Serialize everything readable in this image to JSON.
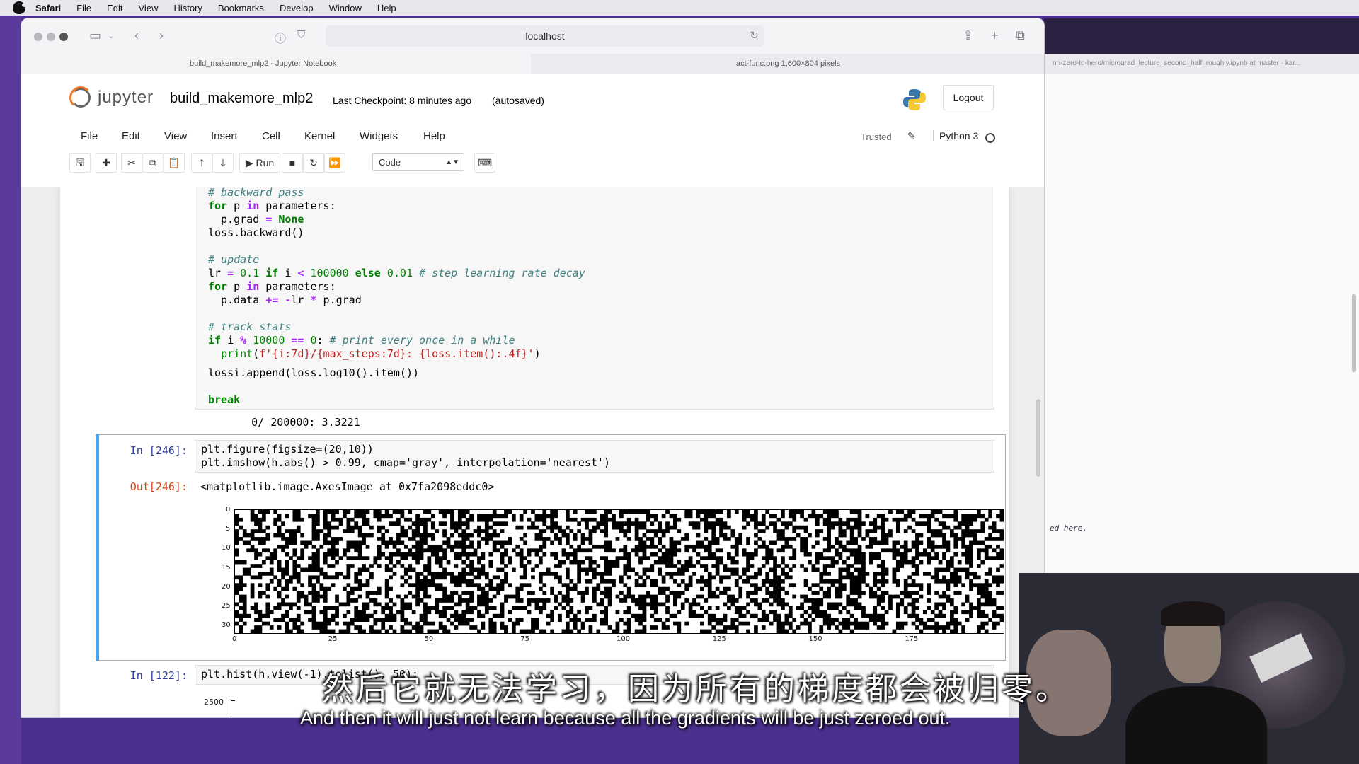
{
  "menubar": {
    "app": "Safari",
    "items": [
      "File",
      "Edit",
      "View",
      "History",
      "Bookmarks",
      "Develop",
      "Window",
      "Help"
    ]
  },
  "safari": {
    "address": "localhost",
    "tabs": [
      {
        "label": "build_makemore_mlp2 - Jupyter Notebook",
        "active": true
      },
      {
        "label": "act-func.png 1,600×804 pixels",
        "active": false
      }
    ]
  },
  "bg_window": {
    "tab": "nn-zero-to-hero/micrograd_lecture_second_half_roughly.ipynb at master · kar...",
    "note": "ed here."
  },
  "jupyter": {
    "logo_text": "jupyter",
    "notebook_name": "build_makemore_mlp2",
    "checkpoint": "Last Checkpoint: 8 minutes ago",
    "autosaved": "(autosaved)",
    "logout": "Logout",
    "menu": [
      "File",
      "Edit",
      "View",
      "Insert",
      "Cell",
      "Kernel",
      "Widgets",
      "Help"
    ],
    "trusted": "Trusted",
    "kernel": "Python 3",
    "run_label": "Run",
    "cell_type": "Code"
  },
  "cells": {
    "cell1_output": "     0/ 200000: 3.3221",
    "cell2_prompt_in": "In [246]:",
    "cell2_line1": "plt.figure(figsize=(20,10))",
    "cell2_line2": "plt.imshow(h.abs() > 0.99, cmap='gray', interpolation='nearest')",
    "cell2_prompt_out": "Out[246]:",
    "cell2_output": "<matplotlib.image.AxesImage at 0x7fa2098eddc0>",
    "cell3_prompt_in": "In [122]:",
    "cell3_line1": "plt.hist(h.view(-1).tolist(), 50);",
    "cell3_ytick": "2500"
  },
  "chart_data": {
    "type": "heatmap",
    "description_source": "imshow of h.abs() > 0.99 (binary, gray colormap)",
    "rows": 32,
    "cols": 200,
    "x_ticks": [
      "0",
      "25",
      "50",
      "75",
      "100",
      "125",
      "150",
      "175"
    ],
    "y_ticks": [
      "0",
      "5",
      "10",
      "15",
      "20",
      "25",
      "30"
    ],
    "colors": {
      "true": "#ffffff",
      "false": "#000000"
    }
  },
  "subtitles": {
    "zh": "然后它就无法学习，因为所有的梯度都会被归零。",
    "en": "And then it will just not learn because all the gradients will be just zeroed out."
  }
}
